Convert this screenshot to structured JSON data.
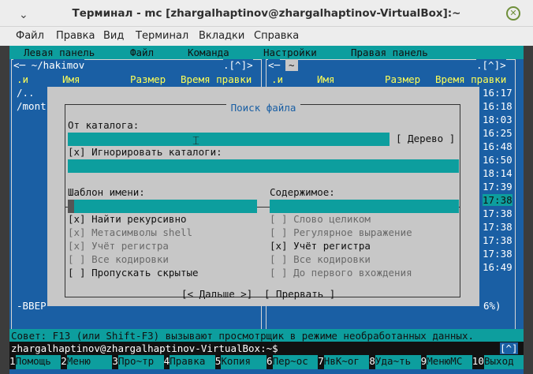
{
  "window": {
    "title": "Терминал - mc [zhargalhaptinov@zhargalhaptinov-VirtualBox]:~",
    "minimize_glyph": "⌄",
    "close_glyph": "✕"
  },
  "menubar": [
    "Файл",
    "Правка",
    "Вид",
    "Терминал",
    "Вкладки",
    "Справка"
  ],
  "mc": {
    "top_menu": [
      "Левая панель",
      "Файл",
      "Команда",
      "Настройки",
      "Правая панель"
    ],
    "left_panel": {
      "path": "<─ ~/hakimov",
      "corner": ".[^]>",
      "col_n": ".и",
      "col_name": "Имя",
      "col_size": "Размер",
      "col_time": "Время правки",
      "rows": [
        "/..",
        "/mont"
      ],
      "bottom": "-ВВЕР"
    },
    "right_panel": {
      "path": "<─",
      "path_tilde": "~",
      "corner": ".[^]>",
      "col_n": ".и",
      "col_name": "Имя",
      "col_size": "Размер",
      "col_time": "Время правки",
      "times": [
        "16:17",
        "16:18",
        "18:03",
        "16:25",
        "16:48",
        "16:50",
        "18:14",
        "17:39",
        "17:38",
        "17:38",
        "17:38",
        "17:38",
        "17:38",
        "16:49"
      ],
      "percent": "6%)"
    },
    "dialog": {
      "title": "Поиск файла",
      "from_dir_label": "От каталога:",
      "tree_button": "[ Дерево ]",
      "ignore_dirs": "[x] Игнорировать каталоги:",
      "name_pattern_label": "Шаблон имени:",
      "content_label": "Содержимое:",
      "left_options": [
        {
          "text": "[x] Найти рекурсивно",
          "enabled": true
        },
        {
          "text": "[x] Метасимволы shell",
          "enabled": false
        },
        {
          "text": "[x] Учёт регистра",
          "enabled": false
        },
        {
          "text": "[ ] Все кодировки",
          "enabled": false
        },
        {
          "text": "[ ] Пропускать скрытые",
          "enabled": true
        }
      ],
      "right_options": [
        {
          "text": "[ ] Слово целиком",
          "enabled": false
        },
        {
          "text": "[ ] Регулярное выражение",
          "enabled": false
        },
        {
          "text": "[x] Учёт регистра",
          "enabled": true
        },
        {
          "text": "[ ] Все кодировки",
          "enabled": false
        },
        {
          "text": "[ ] До первого вхождения",
          "enabled": false
        }
      ],
      "ok_button": "[< Дальше >]",
      "cancel_button": "[ Прервать ]"
    },
    "hint": "Совет: F13 (или Shift-F3) вызывают просмотрщик в режиме необработанных данных.",
    "prompt": "zhargalhaptinov@zhargalhaptinov-VirtualBox:~$",
    "prompt_corner": "[^]",
    "fkeys": [
      {
        "num": "1",
        "label": "Помощь"
      },
      {
        "num": "2",
        "label": "Меню"
      },
      {
        "num": "3",
        "label": "Про~тр"
      },
      {
        "num": "4",
        "label": "Правка"
      },
      {
        "num": "5",
        "label": "Копия"
      },
      {
        "num": "6",
        "label": "Пер~ос"
      },
      {
        "num": "7",
        "label": "НвК~ог"
      },
      {
        "num": "8",
        "label": "Уда~ть"
      },
      {
        "num": "9",
        "label": "МенюМС"
      },
      {
        "num": "10",
        "label": "Выход"
      }
    ]
  },
  "colors": {
    "panel_blue": "#1a5fa4",
    "cyan": "#0d9e9e",
    "dialog_gray": "#c7c7c7",
    "header_yellow": "#ffff55"
  }
}
